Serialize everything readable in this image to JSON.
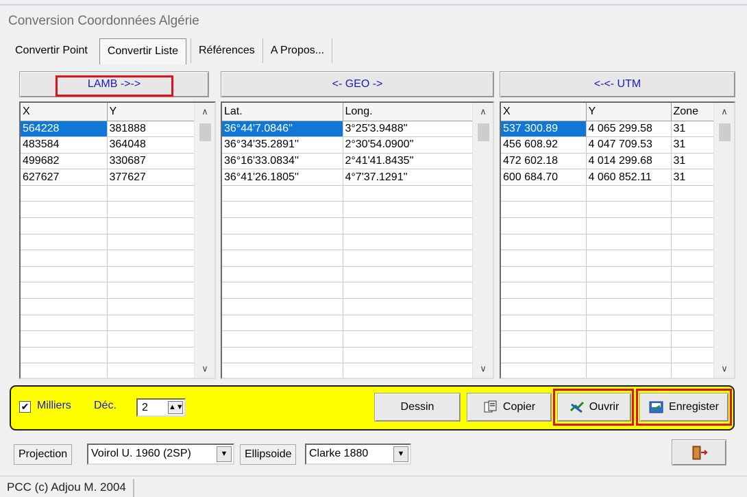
{
  "window": {
    "title": "Conversion Coordonnées Algérie"
  },
  "tabs": [
    {
      "label": "Convertir Point"
    },
    {
      "label": "Convertir Liste"
    },
    {
      "label": "Références"
    },
    {
      "label": "A Propos..."
    }
  ],
  "active_tab": "Convertir Liste",
  "headers": {
    "lamb": "LAMB ->->",
    "geo": "<- GEO ->",
    "utm": "<-<- UTM"
  },
  "lamb_table": {
    "columns": [
      "X",
      "Y"
    ],
    "rows": [
      [
        "564228",
        "381888"
      ],
      [
        "483584",
        "364048"
      ],
      [
        "499682",
        "330687"
      ],
      [
        "627627",
        "377627"
      ]
    ]
  },
  "geo_table": {
    "columns": [
      "Lat.",
      "Long."
    ],
    "rows": [
      [
        "36°44'7.0846''",
        "3°25'3.9488''"
      ],
      [
        "36°34'35.2891''",
        "2°30'54.0900''"
      ],
      [
        "36°16'33.0834''",
        "2°41'41.8435''"
      ],
      [
        "36°41'26.1805''",
        "4°7'37.1291''"
      ]
    ]
  },
  "utm_table": {
    "columns": [
      "X",
      "Y",
      "Zone"
    ],
    "rows": [
      [
        "537 300.89",
        "4 065 299.58",
        "31"
      ],
      [
        "456 608.92",
        "4 047 709.53",
        "31"
      ],
      [
        "472 602.18",
        "4 014 299.68",
        "31"
      ],
      [
        "600 684.70",
        "4 060 852.11",
        "31"
      ]
    ]
  },
  "options": {
    "milliers_label": "Milliers",
    "milliers_checked": true,
    "dec_label": "Déc.",
    "dec_value": "2"
  },
  "buttons": {
    "dessin": "Dessin",
    "copier": "Copier",
    "ouvrir": "Ouvrir",
    "enregistrer": "Enregister"
  },
  "projection": {
    "label": "Projection",
    "value": "Voirol U. 1960 (2SP)"
  },
  "ellipsoide": {
    "label": "Ellipsoide",
    "value": "Clarke 1880"
  },
  "status": {
    "text": "PCC (c) Adjou M. 2004"
  },
  "colors": {
    "highlight_yellow": "#ffff00",
    "selection_blue": "#0f78d7",
    "emphasis_red": "#e0111a",
    "header_text": "#1a1abf"
  },
  "icons": [
    "checkbox-icon",
    "spin-arrows-icon",
    "copy-icon",
    "open-file-icon",
    "save-icon",
    "exit-door-icon",
    "dropdown-arrow-icon",
    "scroll-up-icon",
    "scroll-down-icon"
  ]
}
